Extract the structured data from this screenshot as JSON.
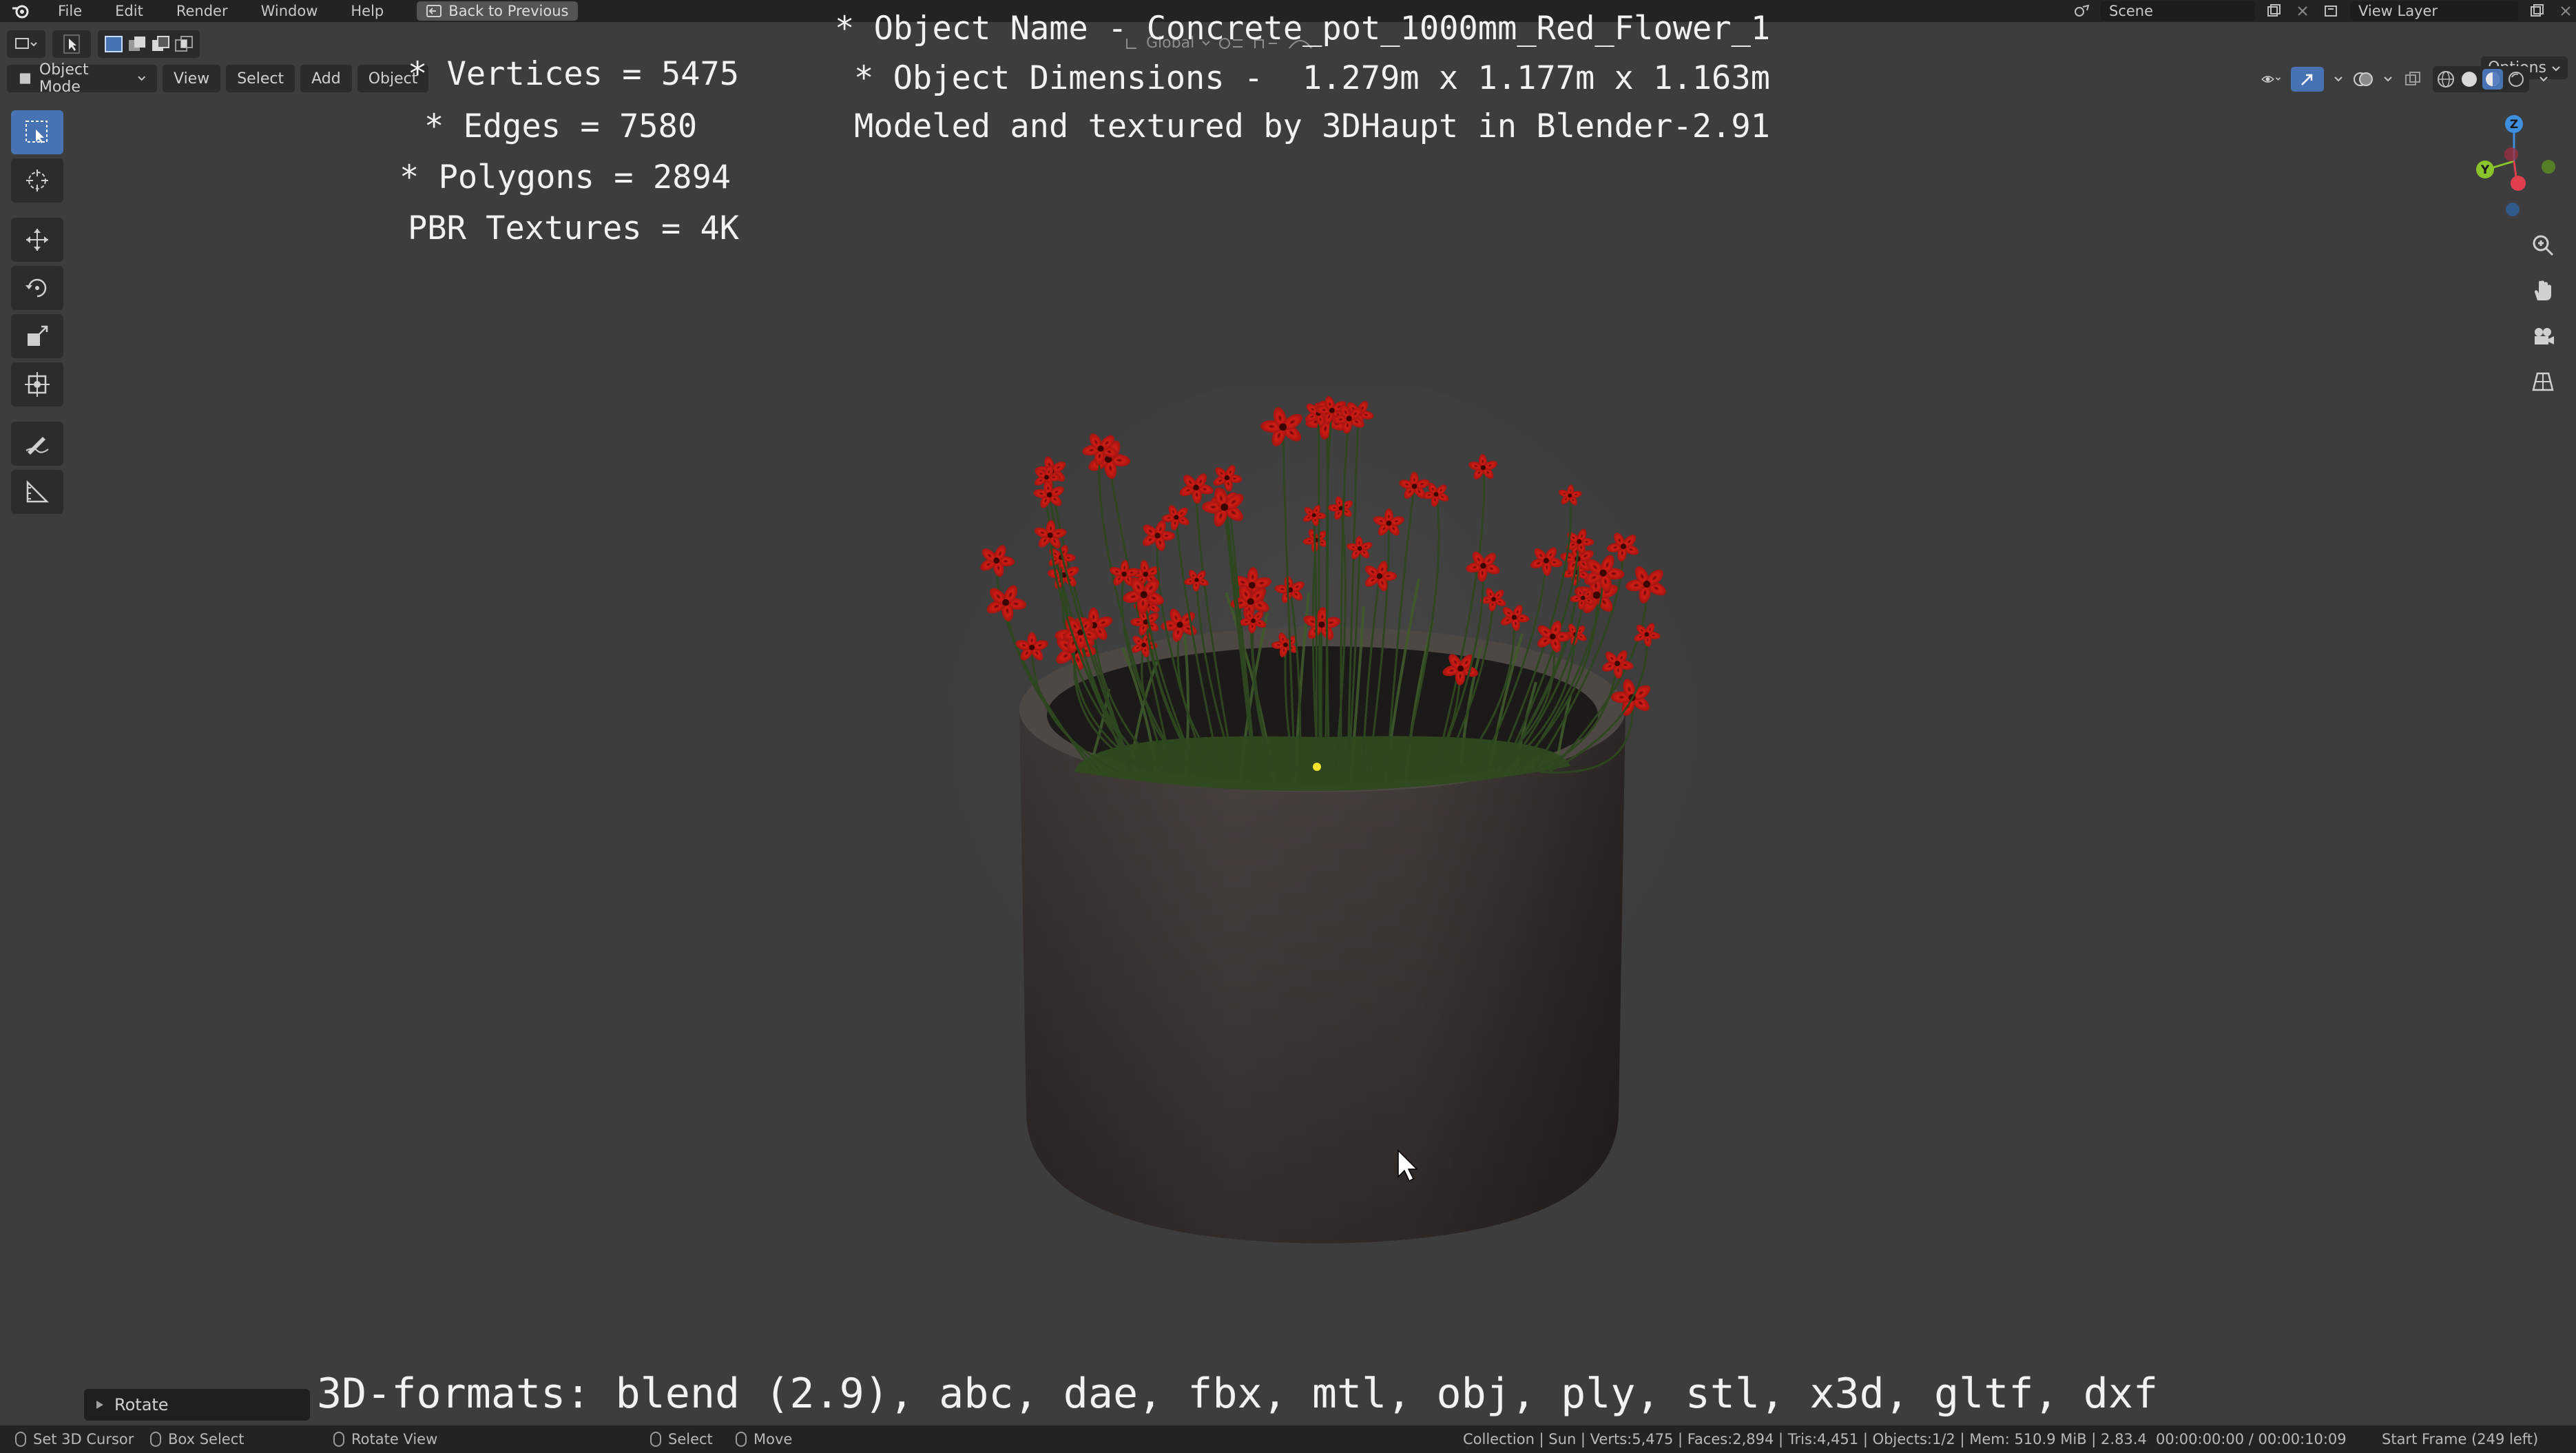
{
  "topbar": {
    "menus": [
      "File",
      "Edit",
      "Render",
      "Window",
      "Help"
    ],
    "back_button": "Back to Previous",
    "scene_label": "Scene",
    "view_layer_label": "View Layer"
  },
  "header": {
    "mode": "Object Mode",
    "menus": [
      "View",
      "Select",
      "Add",
      "Object"
    ],
    "transform_orientation": "Global",
    "options_label": "Options"
  },
  "overlay": {
    "stats": [
      "* Vertices = 5475",
      "* Edges = 7580",
      "* Polygons = 2894",
      "PBR Textures = 4K"
    ],
    "info": [
      "* Object Name - Concrete_pot_1000mm_Red_Flower_1",
      "* Object Dimensions -  1.279m x 1.177m x 1.163m",
      "Modeled and textured by 3DHaupt in Blender-2.91"
    ],
    "formats": "3D-formats: blend (2.9), abc, dae, fbx, mtl, obj, ply, stl, x3d, gltf, dxf"
  },
  "gizmo": {
    "z": "Z",
    "y": "Y"
  },
  "rotate_panel": {
    "label": "Rotate"
  },
  "statusbar": {
    "set_cursor": "Set 3D Cursor",
    "box_select": "Box Select",
    "rotate_view": "Rotate View",
    "select": "Select",
    "move": "Move",
    "stats": "Collection | Sun | Verts:5,475 | Faces:2,894 | Tris:4,451 | Objects:1/2 | Mem: 510.9 MiB | 2.83.4",
    "time": "00:00:00:00 / 00:00:10:09",
    "frame": "Start Frame (249 left)"
  },
  "colors": {
    "accent": "#4772b3",
    "viewport_bg": "#3d3d3d",
    "axis_x": "#e0404d",
    "axis_y": "#8bc32e",
    "axis_z": "#3f8fe0",
    "flower": "#c41a14"
  }
}
